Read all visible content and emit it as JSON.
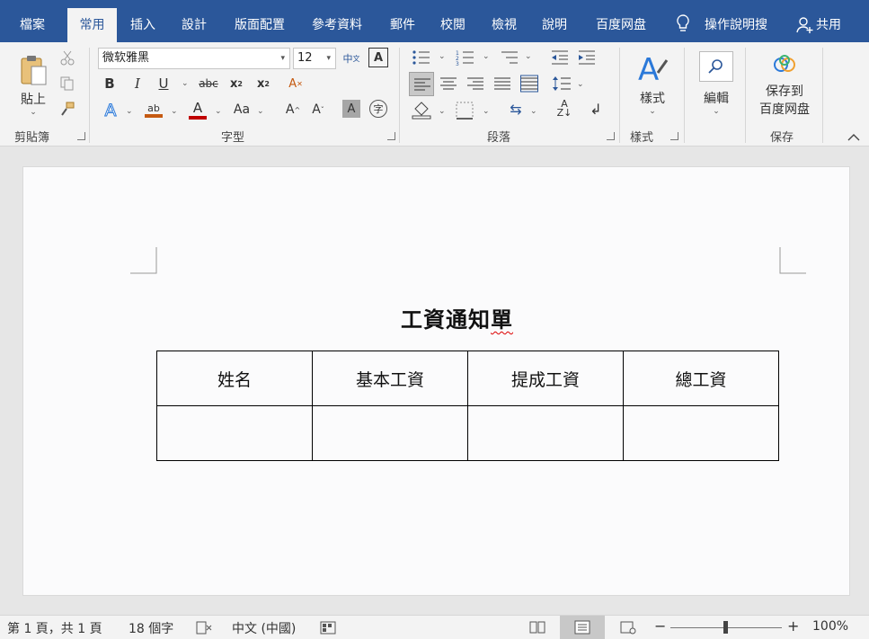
{
  "tabs": [
    {
      "label": "檔案"
    },
    {
      "label": "常用"
    },
    {
      "label": "插入"
    },
    {
      "label": "設計"
    },
    {
      "label": "版面配置"
    },
    {
      "label": "參考資料"
    },
    {
      "label": "郵件"
    },
    {
      "label": "校閱"
    },
    {
      "label": "檢視"
    },
    {
      "label": "說明"
    },
    {
      "label": "百度网盘"
    }
  ],
  "tell_me": "操作說明搜",
  "share": "共用",
  "ribbon": {
    "clipboard": {
      "paste": "貼上",
      "group": "剪貼簿"
    },
    "font": {
      "name": "微软雅黑",
      "size": "12",
      "group": "字型",
      "change_case": "Aa",
      "strike": "abc"
    },
    "paragraph": {
      "group": "段落"
    },
    "styles": {
      "label": "樣式",
      "group": "樣式"
    },
    "editing": {
      "label": "編輯"
    },
    "save": {
      "line1": "保存到",
      "line2": "百度网盘",
      "group": "保存"
    }
  },
  "document": {
    "title_plain": "工資通知",
    "title_flagged": "單",
    "headers": [
      "姓名",
      "基本工資",
      "提成工資",
      "總工資"
    ]
  },
  "status": {
    "page": "第 1 頁，共 1 頁",
    "words": "18 個字",
    "language": "中文 (中國)",
    "zoom": "100%",
    "zoom_minus": "−",
    "zoom_plus": "+"
  },
  "colors": {
    "accent": "#2b579a",
    "highlight_bar": "#c55a11",
    "font_color_bar": "#c00000"
  }
}
